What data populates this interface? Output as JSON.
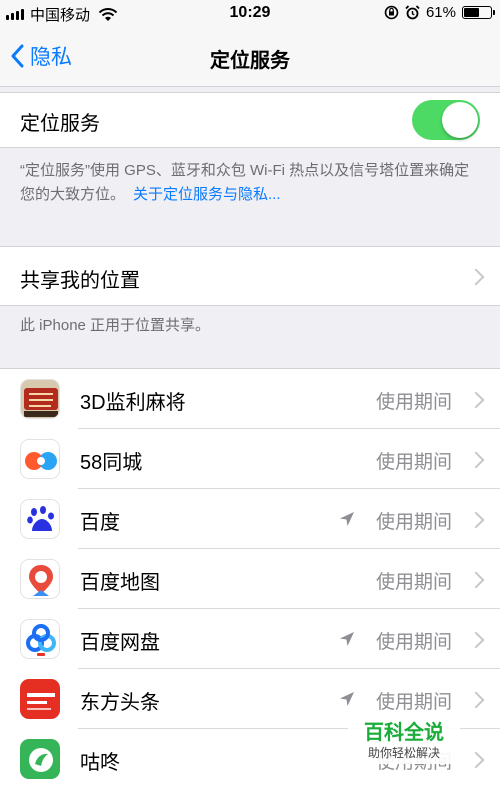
{
  "status_bar": {
    "carrier": "中国移动",
    "time": "10:29",
    "battery_percent": "61%",
    "battery_level": 0.61
  },
  "nav": {
    "back_label": "隐私",
    "title": "定位服务"
  },
  "location_services": {
    "label": "定位服务",
    "enabled": true,
    "footnote": "“定位服务”使用 GPS、蓝牙和众包 Wi-Fi 热点以及信号塔位置来确定您的大致方位。",
    "footnote_link": "关于定位服务与隐私..."
  },
  "share_location": {
    "label": "共享我的位置",
    "footnote": "此 iPhone 正用于位置共享。"
  },
  "apps": [
    {
      "name": "3D监利麻将",
      "permission": "使用期间",
      "recent_location": false,
      "icon": "3d-jianli-mahjong-icon"
    },
    {
      "name": "58同城",
      "permission": "使用期间",
      "recent_location": false,
      "icon": "58-tongcheng-icon"
    },
    {
      "name": "百度",
      "permission": "使用期间",
      "recent_location": true,
      "icon": "baidu-icon"
    },
    {
      "name": "百度地图",
      "permission": "使用期间",
      "recent_location": false,
      "icon": "baidu-map-icon"
    },
    {
      "name": "百度网盘",
      "permission": "使用期间",
      "recent_location": true,
      "icon": "baidu-netdisk-icon"
    },
    {
      "name": "东方头条",
      "permission": "使用期间",
      "recent_location": true,
      "icon": "dongfang-toutiao-icon"
    },
    {
      "name": "咕咚",
      "permission": "使用期间",
      "recent_location": false,
      "icon": "codoon-icon"
    }
  ],
  "watermark": {
    "title": "百科全说",
    "subtitle": "助你轻松解决"
  },
  "colors": {
    "accent": "#0a7bff",
    "toggle_on": "#4cd964",
    "secondary_text": "#8e8e93",
    "background": "#efeff4"
  }
}
